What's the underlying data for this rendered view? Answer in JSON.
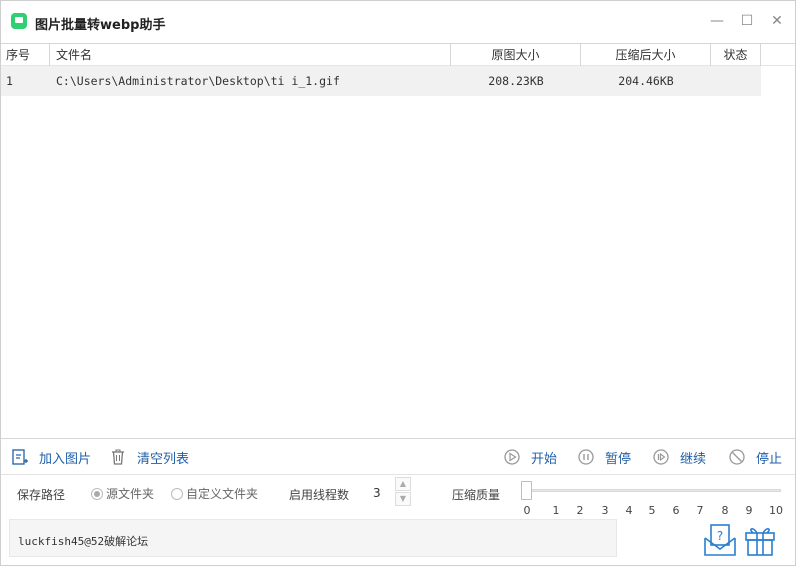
{
  "window": {
    "title": "图片批量转webp助手",
    "controls": {
      "minimize": "—",
      "maximize": "☐",
      "close": "✕"
    }
  },
  "table": {
    "headers": [
      "序号",
      "文件名",
      "原图大小",
      "压缩后大小",
      "状态"
    ],
    "rows": [
      {
        "index": "1",
        "filename": "C:\\Users\\Administrator\\Desktop\\ti        i_1.gif",
        "original_size": "208.23KB",
        "compressed_size": "204.46KB",
        "status": ""
      }
    ]
  },
  "toolbar": {
    "add_label": "加入图片",
    "clear_label": "清空列表",
    "start_label": "开始",
    "pause_label": "暂停",
    "resume_label": "继续",
    "stop_label": "停止"
  },
  "settings": {
    "save_path_label": "保存路径",
    "source_folder_label": "源文件夹",
    "custom_folder_label": "自定义文件夹",
    "selected_option": "源文件夹",
    "threads_label": "启用线程数",
    "threads_value": "3",
    "quality_label": "压缩质量",
    "quality_value": 0,
    "quality_ticks": [
      "0",
      "1",
      "2",
      "3",
      "4",
      "5",
      "6",
      "7",
      "8",
      "9",
      "10"
    ]
  },
  "log": {
    "text": "luckfish45@52破解论坛"
  },
  "colors": {
    "accent": "#1f5fa8",
    "app_icon": "#2fcf72",
    "row_bg": "#f1f1f1"
  },
  "icons": {
    "app": "app-logo-icon",
    "add": "add-image-icon",
    "clear": "trash-icon",
    "start": "play-icon",
    "pause": "pause-icon",
    "resume": "resume-icon",
    "stop": "stop-icon",
    "help": "help-envelope-icon",
    "gift": "gift-icon"
  }
}
